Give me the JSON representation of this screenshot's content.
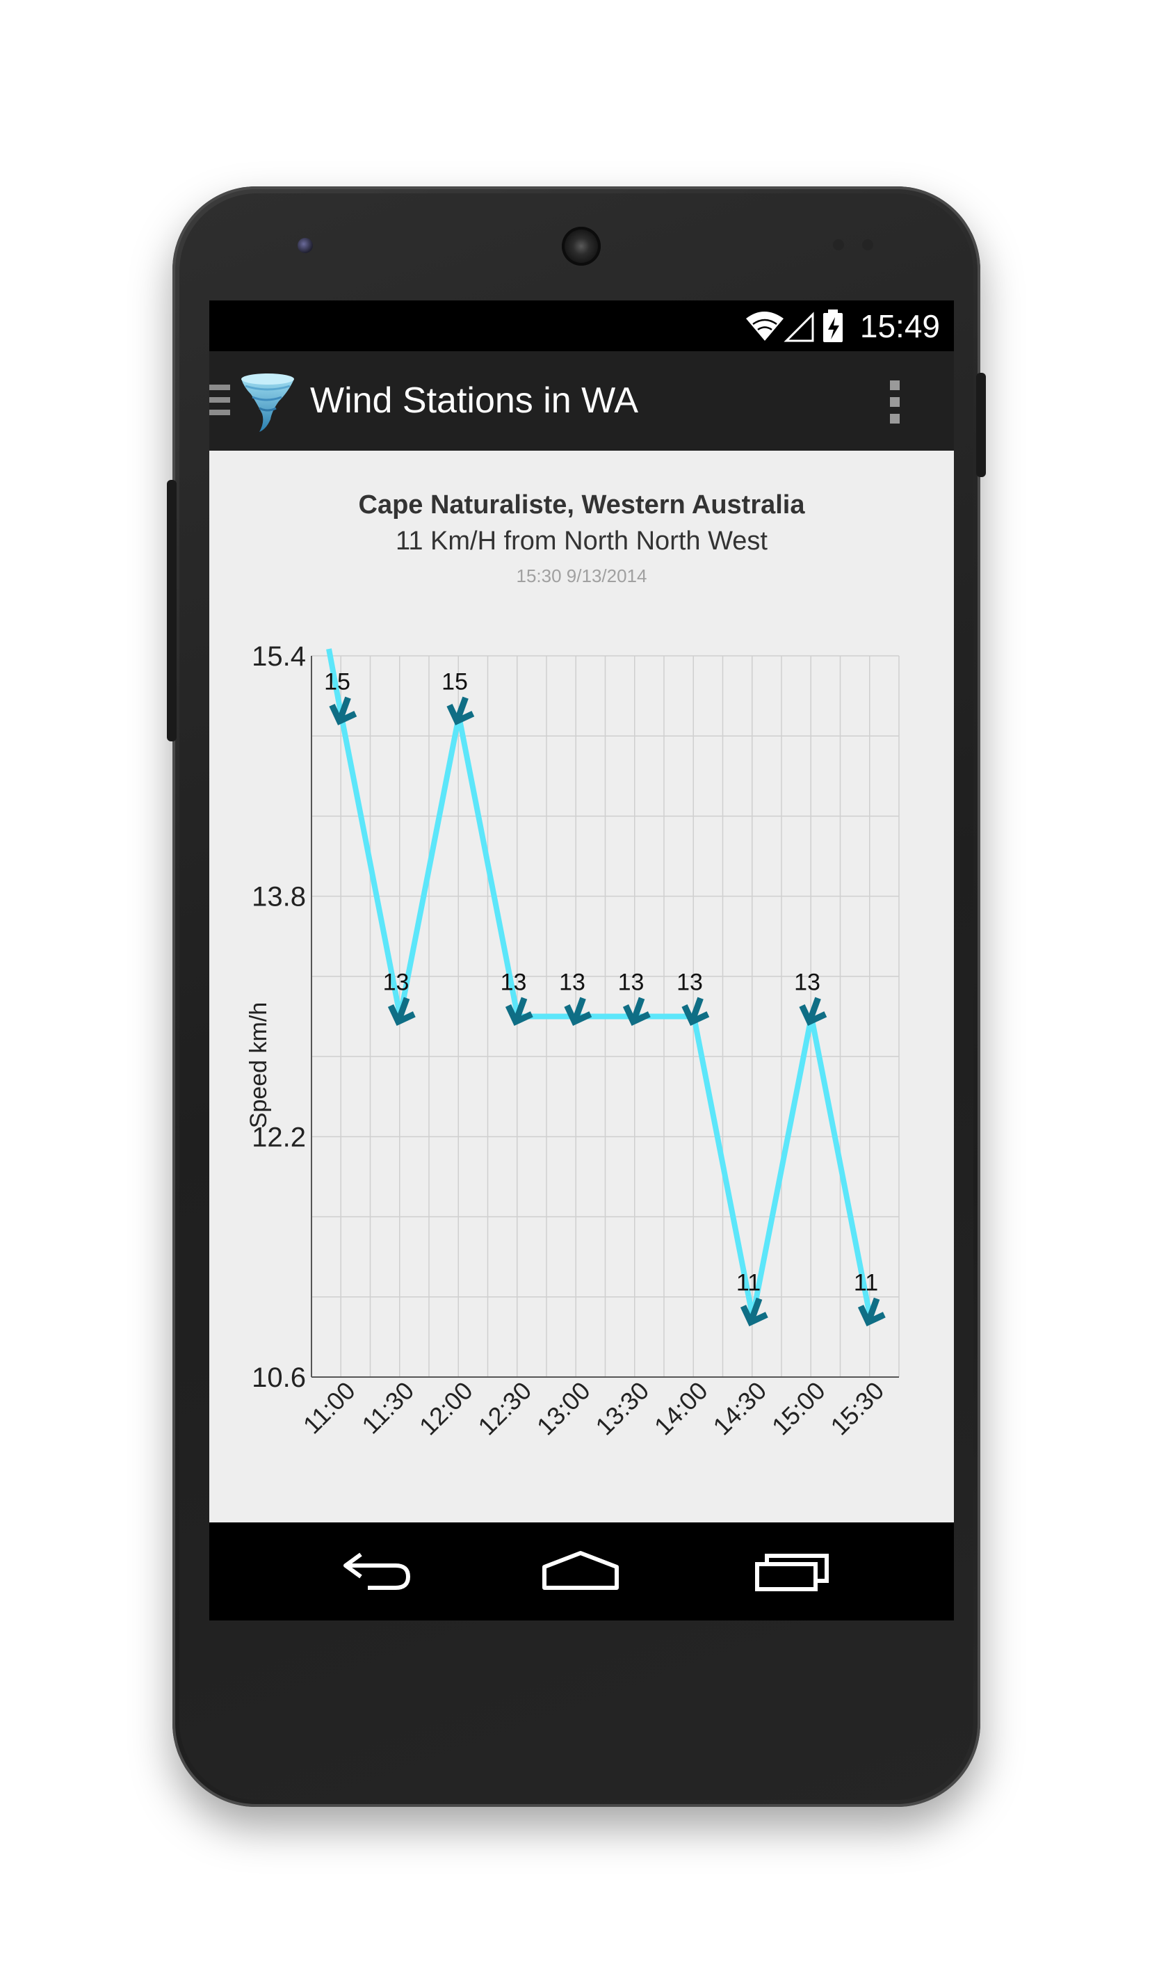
{
  "status_bar": {
    "time": "15:49",
    "icons": [
      "wifi-icon",
      "cell-signal-icon",
      "battery-charging-icon"
    ]
  },
  "action_bar": {
    "title": "Wind Stations in WA",
    "icons": [
      "drawer-menu-icon",
      "tornado-logo-icon",
      "overflow-menu-icon"
    ]
  },
  "station": {
    "name": "Cape Naturaliste, Western Australia",
    "summary": "11 Km/H from North North West",
    "timestamp": "15:30 9/13/2014"
  },
  "chart_data": {
    "type": "line",
    "title": "",
    "xlabel": "",
    "ylabel": "Speed km/h",
    "categories": [
      "11:00",
      "11:30",
      "12:00",
      "12:30",
      "13:00",
      "13:30",
      "14:00",
      "14:30",
      "15:00",
      "15:30"
    ],
    "series": [
      {
        "values": [
          15,
          13,
          15,
          13,
          13,
          13,
          13,
          11,
          13,
          11
        ],
        "point_labels": [
          "15",
          "13",
          "15",
          "13",
          "13",
          "13",
          "13",
          "11",
          "13",
          "11"
        ]
      }
    ],
    "y_ticks": [
      "15.4",
      "13.8",
      "12.2",
      "10.6"
    ],
    "ylim": [
      10.6,
      15.4
    ],
    "grid": true,
    "markers": "arrow (wind direction)",
    "colors": {
      "line": "#5ce6fa",
      "arrow": "#0f6e85",
      "grid": "#cfcfcf"
    }
  },
  "nav_bar": {
    "icons": [
      "back-icon",
      "home-icon",
      "recent-apps-icon"
    ]
  }
}
